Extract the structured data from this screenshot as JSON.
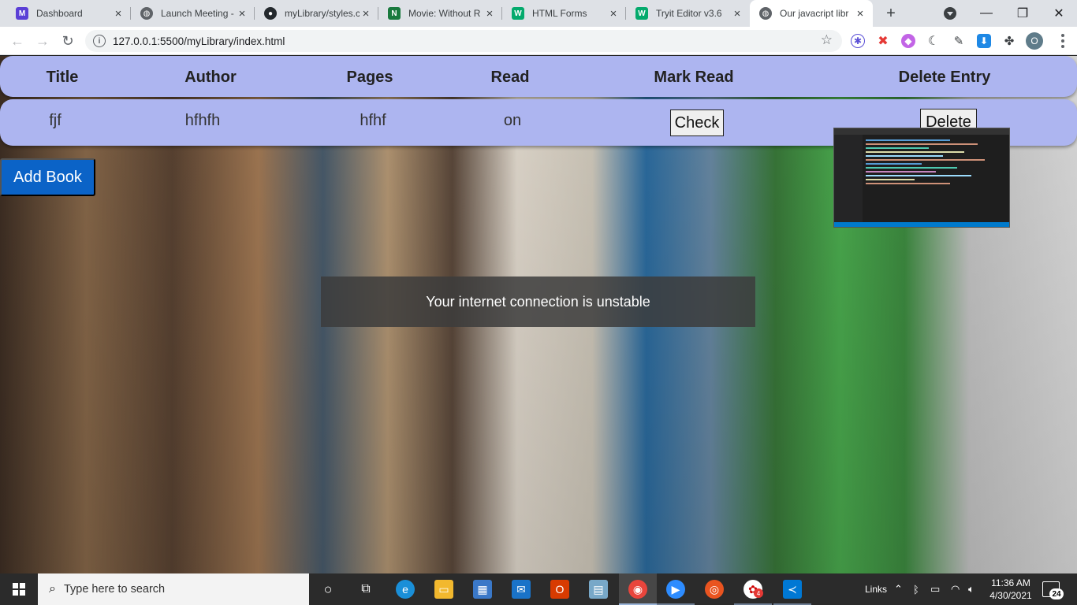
{
  "browser": {
    "tabs": [
      {
        "title": "Dashboard",
        "icon": "multi-icon",
        "color": "#5a3fd6",
        "active": false
      },
      {
        "title": "Launch Meeting -",
        "icon": "globe-icon",
        "color": "#5f6368",
        "active": false
      },
      {
        "title": "myLibrary/styles.c",
        "icon": "github-icon",
        "color": "#24292e",
        "active": false
      },
      {
        "title": "Movie: Without R",
        "icon": "n-icon",
        "color": "#1a7a3e",
        "active": false
      },
      {
        "title": "HTML Forms",
        "icon": "w3-icon",
        "color": "#04aa6d",
        "active": false
      },
      {
        "title": "Tryit Editor v3.6",
        "icon": "w3-icon",
        "color": "#04aa6d",
        "active": false
      },
      {
        "title": "Our javacript libr",
        "icon": "globe-icon",
        "color": "#5f6368",
        "active": true
      }
    ],
    "new_tab_symbol": "+",
    "url": "127.0.0.1:5500/myLibrary/index.html",
    "profile_initial": "O"
  },
  "table": {
    "headers": [
      "Title",
      "Author",
      "Pages",
      "Read",
      "Mark Read",
      "Delete Entry"
    ],
    "row": {
      "title": "fjf",
      "author": "hfhfh",
      "pages": "hfhf",
      "read": "on"
    },
    "check_label": "Check",
    "delete_label": "Delete",
    "header_bg": "#adb5f0"
  },
  "add_book_label": "Add Book",
  "toast": "Your internet connection is unstable",
  "taskbar": {
    "search_placeholder": "Type here to search",
    "links_label": "Links",
    "time": "11:36 AM",
    "date": "4/30/2021",
    "notification_count": "24",
    "teams_badge": "4"
  }
}
